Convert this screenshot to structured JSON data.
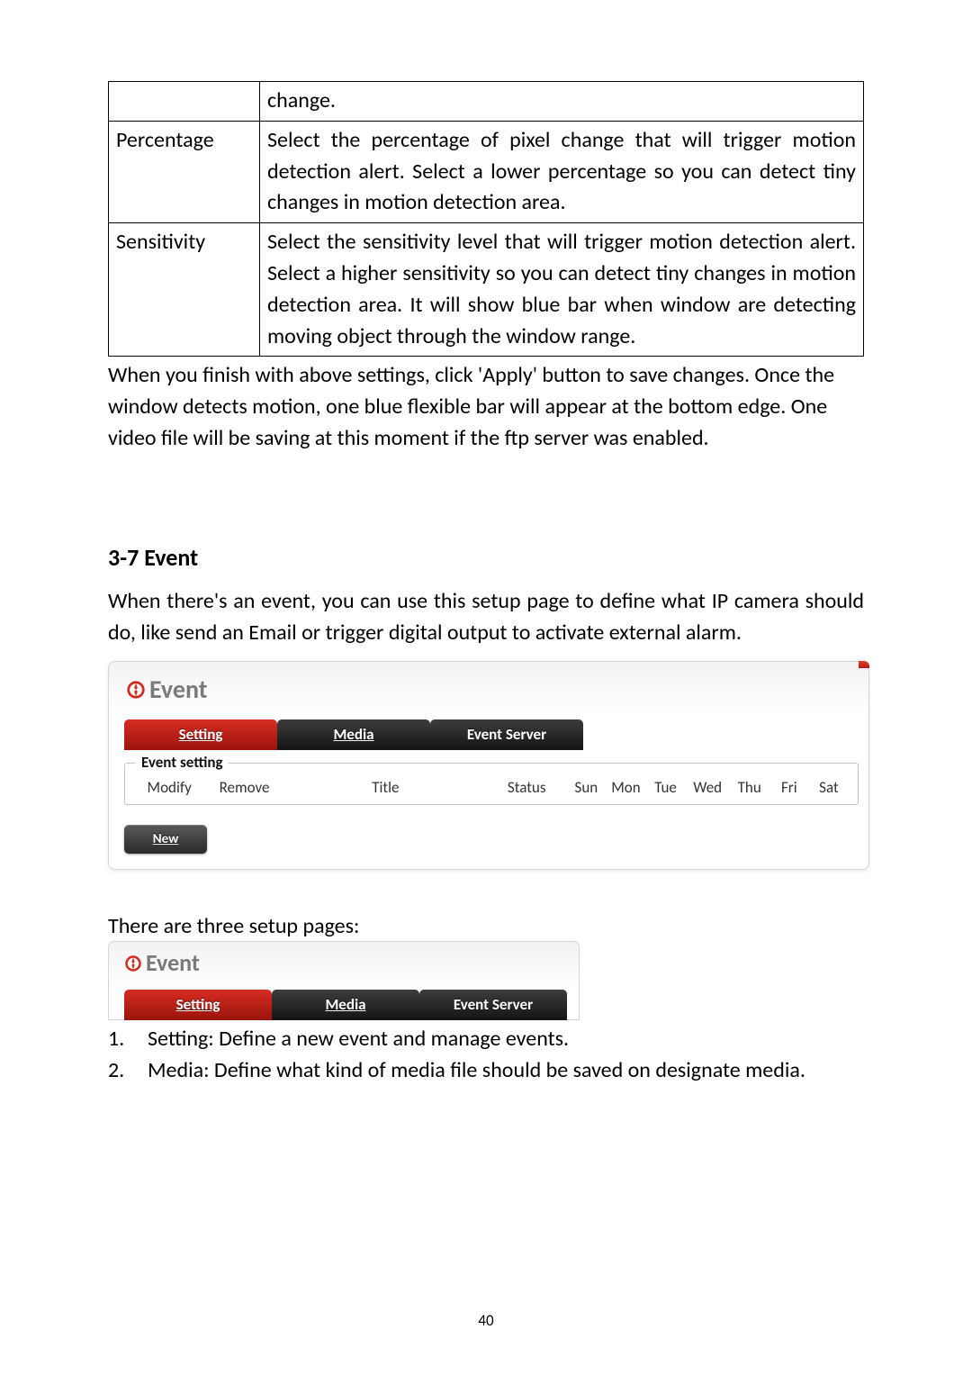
{
  "table": {
    "rows": [
      {
        "label": "",
        "desc": "change."
      },
      {
        "label": "Percentage",
        "desc": "Select the percentage of pixel change that will trigger motion detection alert. Select a lower percentage so you can detect tiny changes in motion detection area."
      },
      {
        "label": "Sensitivity",
        "desc": "Select the sensitivity level that will trigger motion detection alert. Select a higher sensitivity so you can detect tiny changes in motion detection area. It will show blue bar when window are detecting moving object through the window range."
      }
    ]
  },
  "para_after_table": "When you finish with above settings, click 'Apply' button to save changes. Once the window detects motion, one blue flexible bar will appear at the bottom edge. One video file will be saving at this moment if the ftp server was enabled.",
  "section_heading": "3-7 Event",
  "section_intro": "When there's an event, you can use this setup page to define what IP camera should do, like send an Email or trigger digital output to activate external alarm.",
  "event_panel": {
    "title": "Event",
    "tabs": {
      "setting": "Setting",
      "media": "Media",
      "server": "Event Server"
    },
    "fieldset_legend": "Event setting",
    "columns": [
      "Modify",
      "Remove",
      "Title",
      "Status",
      "Sun",
      "Mon",
      "Tue",
      "Wed",
      "Thu",
      "Fri",
      "Sat"
    ],
    "new_btn": "New"
  },
  "three_pages_intro": "There are three setup pages:",
  "list_items": [
    {
      "n": "1.",
      "t": "Setting: Define a new event and manage events."
    },
    {
      "n": "2.",
      "t": "Media: Define what kind of media file should be saved on designate media."
    }
  ],
  "page_number": "40"
}
